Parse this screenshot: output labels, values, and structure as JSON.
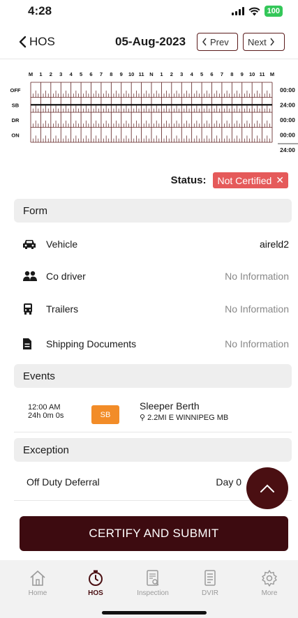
{
  "status_bar": {
    "time": "4:28",
    "battery": "100"
  },
  "header": {
    "back_label": "HOS",
    "date": "05-Aug-2023",
    "prev_label": "Prev",
    "next_label": "Next"
  },
  "graph": {
    "hour_labels": [
      "M",
      "1",
      "2",
      "3",
      "4",
      "5",
      "6",
      "7",
      "8",
      "9",
      "10",
      "11",
      "N",
      "1",
      "2",
      "3",
      "4",
      "5",
      "6",
      "7",
      "8",
      "9",
      "10",
      "11",
      "M"
    ],
    "rows": [
      "OFF",
      "SB",
      "DR",
      "ON"
    ],
    "totals": [
      "00:00",
      "24:00",
      "00:00",
      "00:00"
    ],
    "grand_total": "24:00",
    "active_status": "SB",
    "line_color": "#5a1a1a"
  },
  "status": {
    "label": "Status:",
    "badge": "Not Certified",
    "badge_color": "#e55a5a"
  },
  "form": {
    "title": "Form",
    "rows": [
      {
        "icon": "car-icon",
        "label": "Vehicle",
        "value": "aireld2"
      },
      {
        "icon": "users-icon",
        "label": "Co driver",
        "value": "No Information"
      },
      {
        "icon": "truck-icon",
        "label": "Trailers",
        "value": "No Information"
      },
      {
        "icon": "document-icon",
        "label": "Shipping Documents",
        "value": "No Information"
      }
    ]
  },
  "events": {
    "title": "Events",
    "items": [
      {
        "time": "12:00 AM",
        "duration": "24h 0m 0s",
        "badge": "SB",
        "type": "Sleeper Berth",
        "location": "2.2MI E WINNIPEG MB"
      }
    ]
  },
  "exception": {
    "title": "Exception",
    "rows": [
      {
        "label": "Off Duty Deferral",
        "value": "Day 0"
      }
    ]
  },
  "certify_button": "CERTIFY AND SUBMIT",
  "tabs": [
    {
      "label": "Home",
      "icon": "home-icon"
    },
    {
      "label": "HOS",
      "icon": "stopwatch-icon"
    },
    {
      "label": "Inspection",
      "icon": "inspection-icon"
    },
    {
      "label": "DVIR",
      "icon": "dvir-icon"
    },
    {
      "label": "More",
      "icon": "gear-icon"
    }
  ],
  "active_tab": "HOS",
  "colors": {
    "brand": "#3d0b10",
    "sb_badge": "#f28c28",
    "battery": "#34c759"
  }
}
